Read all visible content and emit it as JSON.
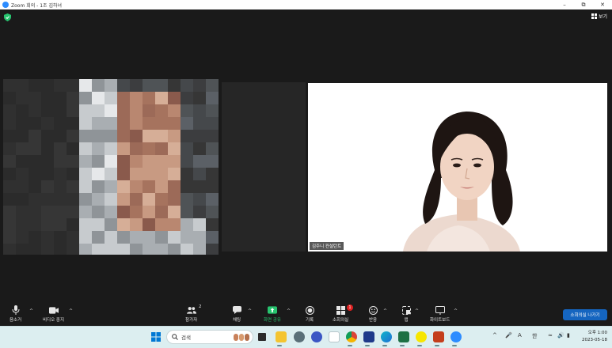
{
  "window": {
    "title": "Zoom 회의 - 1조 김하녀"
  },
  "meeting": {
    "view_label": "보기",
    "participants": [
      {
        "name_tag": ""
      },
      {
        "name_tag": "김주니 컨설턴트"
      }
    ]
  },
  "toolbar": {
    "mute_label": "음소거",
    "video_label": "비디오 중지",
    "participants_label": "참가자",
    "participants_count": "2",
    "chat_label": "채팅",
    "share_label": "화면 공유",
    "record_label": "기록",
    "breakout_label": "소회의실",
    "breakout_badge": "1",
    "reactions_label": "반응",
    "apps_label": "앱",
    "whiteboard_label": "화이트보드",
    "leave_label": "소회의실 나가기"
  },
  "taskbar": {
    "search_placeholder": "검색",
    "ime_a": "A",
    "ime_han": "한",
    "time": "오후 1:00",
    "date": "2023-05-18"
  },
  "colors": {
    "accent": "#2d8cff",
    "share_green": "#27c46f",
    "leave_blue": "#1565c0",
    "badge_red": "#e02020"
  }
}
